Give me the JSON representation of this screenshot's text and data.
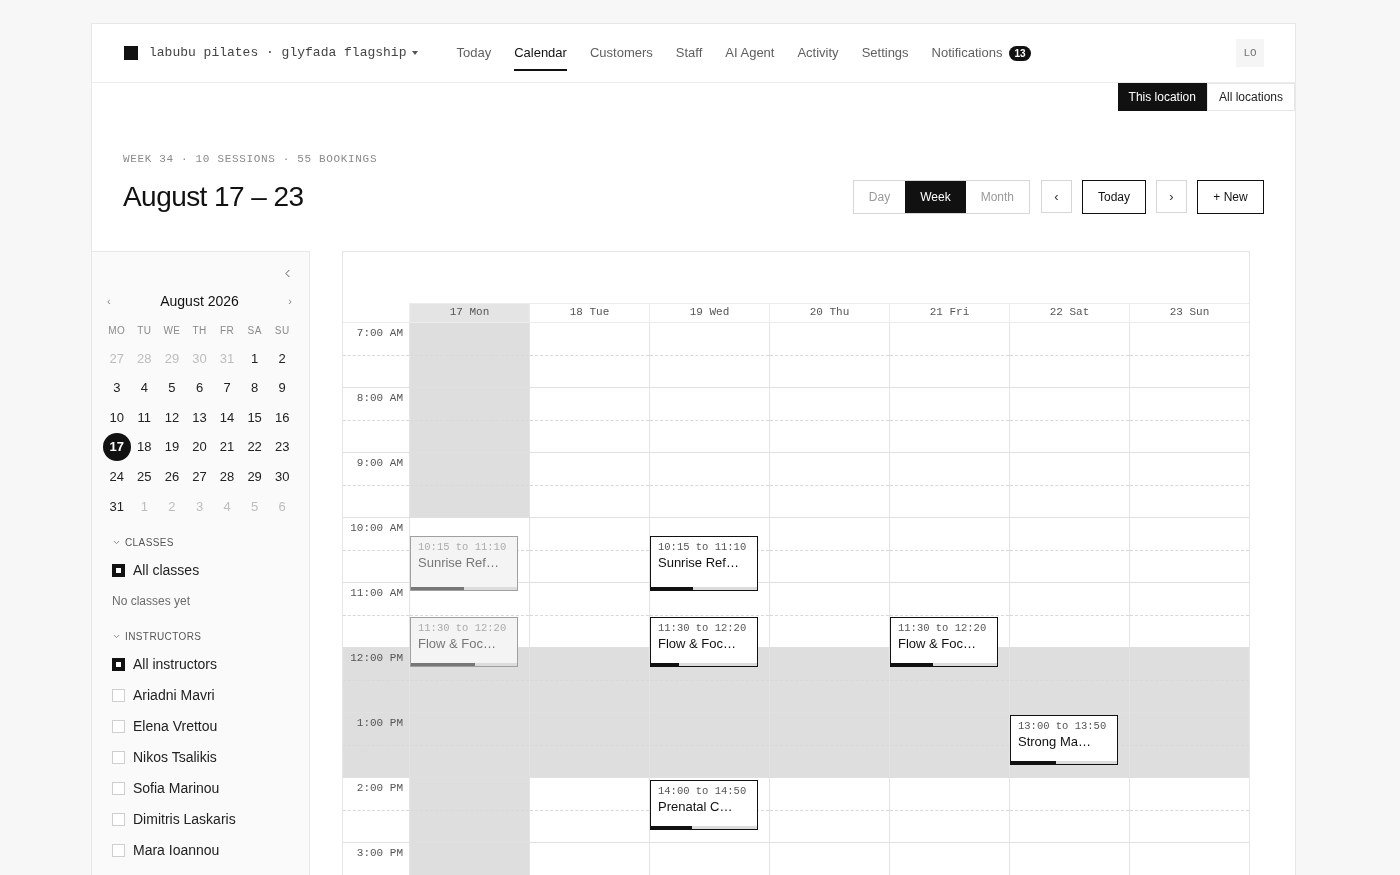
{
  "brand": {
    "name": "labubu pilates · glyfada flagship"
  },
  "nav": [
    {
      "label": "Today",
      "selected": false
    },
    {
      "label": "Calendar",
      "selected": true
    },
    {
      "label": "Customers",
      "selected": false
    },
    {
      "label": "Staff",
      "selected": false
    },
    {
      "label": "AI Agent",
      "selected": false
    },
    {
      "label": "Activity",
      "selected": false
    },
    {
      "label": "Settings",
      "selected": false
    },
    {
      "label": "Notifications",
      "selected": false,
      "badge": "13"
    }
  ],
  "user": {
    "initials": "LO"
  },
  "location_scope": [
    {
      "label": "This location",
      "selected": true
    },
    {
      "label": "All locations",
      "selected": false
    }
  ],
  "header": {
    "summary": "WEEK 34 · 10 SESSIONS · 55 BOOKINGS",
    "title": "August 17 – 23"
  },
  "toolbar": {
    "views": [
      {
        "label": "Day",
        "selected": false
      },
      {
        "label": "Week",
        "selected": true
      },
      {
        "label": "Month",
        "selected": false
      }
    ],
    "prev": "‹",
    "today": "Today",
    "next": "›",
    "new": "+ New"
  },
  "sidebar": {
    "mini_calendar": {
      "month": "August 2026",
      "prev": "‹",
      "next": "›",
      "weekdays": [
        "MO",
        "TU",
        "WE",
        "TH",
        "FR",
        "SA",
        "SU"
      ],
      "weeks": [
        [
          {
            "day": "27",
            "outside": true,
            "selected": false
          },
          {
            "day": "28",
            "outside": true,
            "selected": false
          },
          {
            "day": "29",
            "outside": true,
            "selected": false
          },
          {
            "day": "30",
            "outside": true,
            "selected": false
          },
          {
            "day": "31",
            "outside": true,
            "selected": false
          },
          {
            "day": "1",
            "outside": false,
            "selected": false
          },
          {
            "day": "2",
            "outside": false,
            "selected": false
          }
        ],
        [
          {
            "day": "3",
            "outside": false,
            "selected": false
          },
          {
            "day": "4",
            "outside": false,
            "selected": false
          },
          {
            "day": "5",
            "outside": false,
            "selected": false
          },
          {
            "day": "6",
            "outside": false,
            "selected": false
          },
          {
            "day": "7",
            "outside": false,
            "selected": false
          },
          {
            "day": "8",
            "outside": false,
            "selected": false
          },
          {
            "day": "9",
            "outside": false,
            "selected": false
          }
        ],
        [
          {
            "day": "10",
            "outside": false,
            "selected": false
          },
          {
            "day": "11",
            "outside": false,
            "selected": false
          },
          {
            "day": "12",
            "outside": false,
            "selected": false
          },
          {
            "day": "13",
            "outside": false,
            "selected": false
          },
          {
            "day": "14",
            "outside": false,
            "selected": false
          },
          {
            "day": "15",
            "outside": false,
            "selected": false
          },
          {
            "day": "16",
            "outside": false,
            "selected": false
          }
        ],
        [
          {
            "day": "17",
            "outside": false,
            "selected": true
          },
          {
            "day": "18",
            "outside": false,
            "selected": false
          },
          {
            "day": "19",
            "outside": false,
            "selected": false
          },
          {
            "day": "20",
            "outside": false,
            "selected": false
          },
          {
            "day": "21",
            "outside": false,
            "selected": false
          },
          {
            "day": "22",
            "outside": false,
            "selected": false
          },
          {
            "day": "23",
            "outside": false,
            "selected": false
          }
        ],
        [
          {
            "day": "24",
            "outside": false,
            "selected": false
          },
          {
            "day": "25",
            "outside": false,
            "selected": false
          },
          {
            "day": "26",
            "outside": false,
            "selected": false
          },
          {
            "day": "27",
            "outside": false,
            "selected": false
          },
          {
            "day": "28",
            "outside": false,
            "selected": false
          },
          {
            "day": "29",
            "outside": false,
            "selected": false
          },
          {
            "day": "30",
            "outside": false,
            "selected": false
          }
        ],
        [
          {
            "day": "31",
            "outside": false,
            "selected": false
          },
          {
            "day": "1",
            "outside": true,
            "selected": false
          },
          {
            "day": "2",
            "outside": true,
            "selected": false
          },
          {
            "day": "3",
            "outside": true,
            "selected": false
          },
          {
            "day": "4",
            "outside": true,
            "selected": false
          },
          {
            "day": "5",
            "outside": true,
            "selected": false
          },
          {
            "day": "6",
            "outside": true,
            "selected": false
          }
        ]
      ]
    },
    "sections": [
      {
        "title": "CLASSES",
        "expanded": true,
        "items": [
          {
            "label": "All classes",
            "checked": true
          }
        ],
        "empty_note": "No classes yet"
      },
      {
        "title": "INSTRUCTORS",
        "expanded": true,
        "items": [
          {
            "label": "All instructors",
            "checked": true
          },
          {
            "label": "Ariadni Mavri",
            "checked": false
          },
          {
            "label": "Elena Vrettou",
            "checked": false
          },
          {
            "label": "Nikos Tsalikis",
            "checked": false
          },
          {
            "label": "Sofia Marinou",
            "checked": false
          },
          {
            "label": "Dimitris Laskaris",
            "checked": false
          },
          {
            "label": "Mara Ioannou",
            "checked": false
          }
        ]
      }
    ]
  },
  "calendar": {
    "hours": [
      {
        "label": "7:00 AM",
        "shaded": false
      },
      {
        "label": "8:00 AM",
        "shaded": false
      },
      {
        "label": "9:00 AM",
        "shaded": false
      },
      {
        "label": "10:00 AM",
        "shaded": false
      },
      {
        "label": "11:00 AM",
        "shaded": false
      },
      {
        "label": "12:00 PM",
        "shaded": true
      },
      {
        "label": "1:00 PM",
        "shaded": true
      },
      {
        "label": "2:00 PM",
        "shaded": false
      },
      {
        "label": "3:00 PM",
        "shaded": false
      }
    ],
    "days": [
      {
        "label": "17 Mon",
        "selected": true,
        "shaded_hours": [
          true,
          true,
          true,
          false,
          false,
          true,
          true,
          true,
          true
        ],
        "events": [
          {
            "time": "10:15 to 11:10",
            "title": "Sunrise Ref…",
            "faded": true,
            "level": 0.5
          },
          {
            "time": "11:30 to 12:20",
            "title": "Flow & Foc…",
            "faded": true,
            "level": 0.6
          }
        ]
      },
      {
        "label": "18 Tue",
        "selected": false,
        "shaded_hours": [
          false,
          false,
          false,
          false,
          false,
          true,
          true,
          false,
          false
        ]
      },
      {
        "label": "19 Wed",
        "selected": false,
        "shaded_hours": [
          false,
          false,
          false,
          false,
          false,
          true,
          true,
          false,
          false
        ],
        "events": [
          {
            "time": "10:15 to 11:10",
            "title": "Sunrise Ref…",
            "faded": false,
            "level": 0.4
          },
          {
            "time": "11:30 to 12:20",
            "title": "Flow & Foc…",
            "faded": false,
            "level": 0.26
          },
          {
            "time": "14:00 to 14:50",
            "title": "Prenatal C…",
            "faded": false,
            "level": 0.39
          }
        ]
      },
      {
        "label": "20 Thu",
        "selected": false,
        "shaded_hours": [
          false,
          false,
          false,
          false,
          false,
          true,
          true,
          false,
          false
        ]
      },
      {
        "label": "21 Fri",
        "selected": false,
        "shaded_hours": [
          false,
          false,
          false,
          false,
          false,
          true,
          true,
          false,
          false
        ],
        "events": [
          {
            "time": "11:30 to 12:20",
            "title": "Flow & Foc…",
            "faded": false,
            "level": 0.4
          }
        ]
      },
      {
        "label": "22 Sat",
        "selected": false,
        "shaded_hours": [
          false,
          false,
          false,
          false,
          false,
          true,
          true,
          false,
          false
        ],
        "events": [
          {
            "time": "13:00 to 13:50",
            "title": "Strong Ma…",
            "faded": false,
            "level": 0.42
          }
        ]
      },
      {
        "label": "23 Sun",
        "selected": false,
        "shaded_hours": [
          false,
          false,
          false,
          false,
          false,
          true,
          true,
          false,
          false
        ]
      }
    ]
  }
}
